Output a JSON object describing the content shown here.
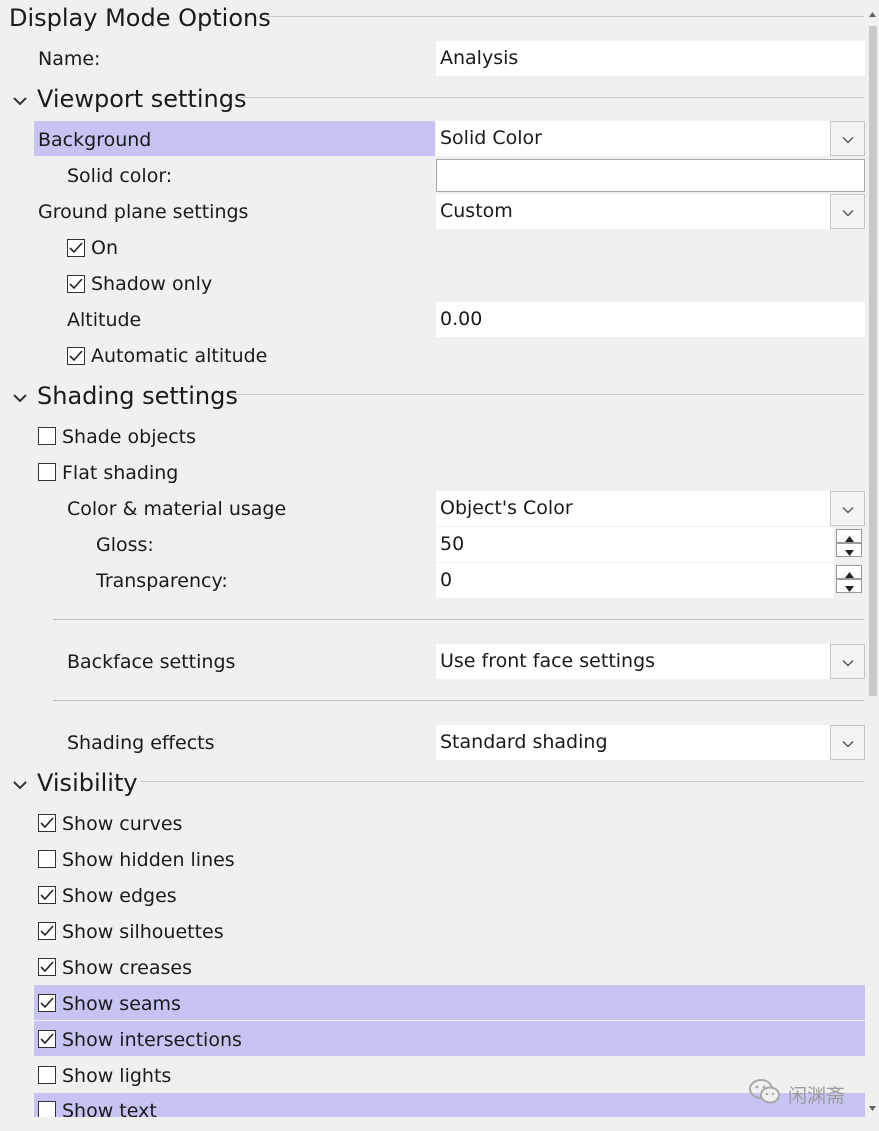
{
  "title": "Display Mode Options",
  "name_label": "Name:",
  "name_value": "Analysis",
  "sections": {
    "viewport": "Viewport settings",
    "shading": "Shading settings",
    "visibility": "Visibility"
  },
  "viewport": {
    "background_label": "Background",
    "background_value": "Solid Color",
    "solid_color_label": "Solid color:",
    "solid_color_value": "#ffffff",
    "ground_plane_label": "Ground plane settings",
    "ground_plane_value": "Custom",
    "on_label": "On",
    "on_checked": true,
    "shadow_only_label": "Shadow only",
    "shadow_only_checked": true,
    "altitude_label": "Altitude",
    "altitude_value": "0.00",
    "auto_altitude_label": "Automatic altitude",
    "auto_altitude_checked": true
  },
  "shading": {
    "shade_objects_label": "Shade objects",
    "shade_objects_checked": false,
    "flat_shading_label": "Flat shading",
    "flat_shading_checked": false,
    "color_material_label": "Color & material usage",
    "color_material_value": "Object's Color",
    "gloss_label": "Gloss:",
    "gloss_value": "50",
    "transparency_label": "Transparency:",
    "transparency_value": "0",
    "backface_label": "Backface settings",
    "backface_value": "Use front face settings",
    "effects_label": "Shading effects",
    "effects_value": "Standard shading"
  },
  "visibility": {
    "show_curves": "Show curves",
    "show_curves_checked": true,
    "show_hidden_lines": "Show hidden lines",
    "show_hidden_lines_checked": false,
    "show_edges": "Show edges",
    "show_edges_checked": true,
    "show_silhouettes": "Show silhouettes",
    "show_silhouettes_checked": true,
    "show_creases": "Show creases",
    "show_creases_checked": true,
    "show_seams": "Show seams",
    "show_seams_checked": true,
    "show_intersections": "Show intersections",
    "show_intersections_checked": true,
    "show_lights": "Show lights",
    "show_lights_checked": false,
    "show_text": "Show text",
    "show_text_checked": false
  },
  "watermark": "闲渊斋",
  "colors": {
    "highlight": "#c7c3f3",
    "background": "#f0f0f0",
    "field": "#ffffff"
  },
  "icons": {
    "section_toggle": "chevron-down-icon",
    "dropdown": "chevron-down-icon",
    "checkbox": "check-icon",
    "watermark_logo": "wechat-icon"
  }
}
